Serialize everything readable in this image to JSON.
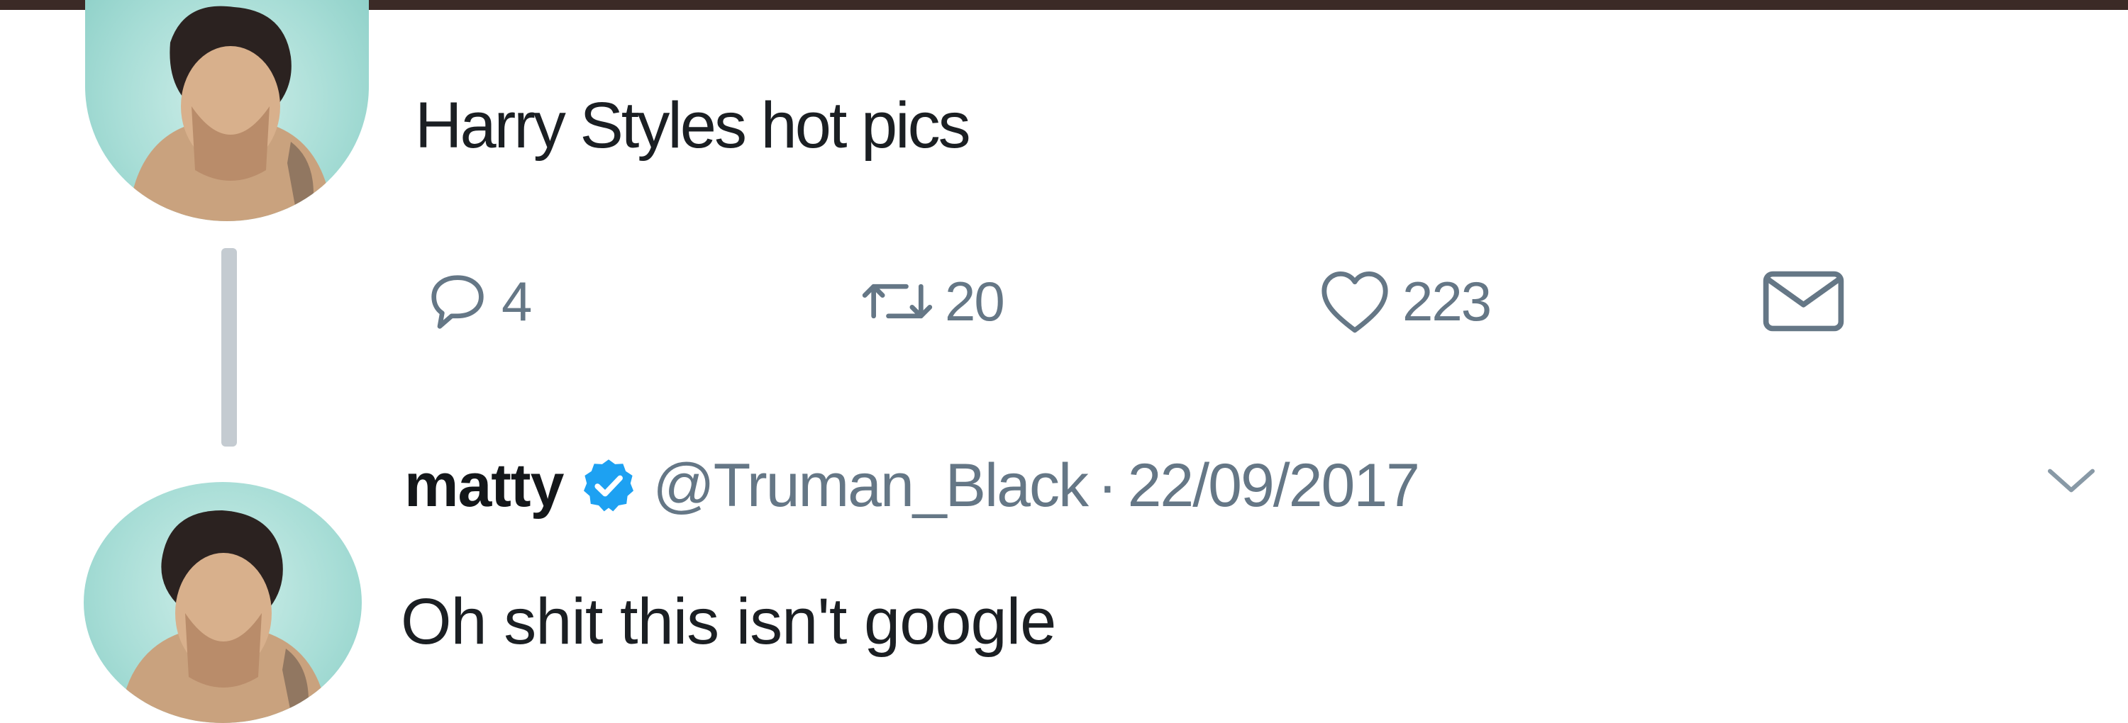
{
  "colors": {
    "text": "#14171a",
    "muted": "#657786",
    "verified": "#1da1f2",
    "thread_line": "#c4cbd1",
    "top_bar": "#3b2a26"
  },
  "tweet": {
    "text": "Harry Styles hot pics",
    "actions": {
      "reply_icon": "reply-bubble-icon",
      "reply_count": "4",
      "retweet_icon": "retweet-icon",
      "retweet_count": "20",
      "like_icon": "heart-icon",
      "like_count": "223",
      "dm_icon": "envelope-icon"
    }
  },
  "reply": {
    "display_name": "matty",
    "verified_icon": "verified-badge-icon",
    "handle": "@Truman_Black",
    "separator": "·",
    "date": "22/09/2017",
    "menu_icon": "chevron-down-icon",
    "text": "Oh shit this isn't google"
  }
}
